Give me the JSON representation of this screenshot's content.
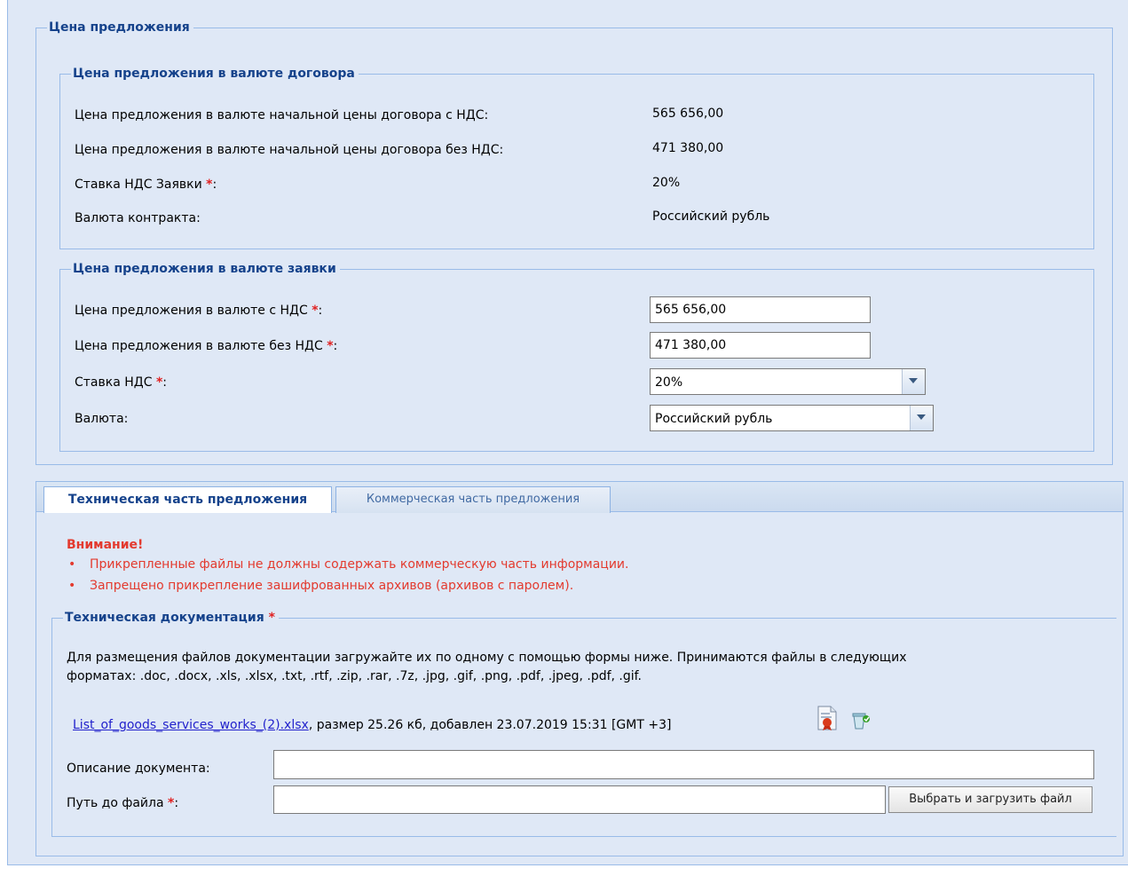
{
  "offer_price": {
    "legend": "Цена предложения",
    "contract_currency": {
      "legend": "Цена предложения в валюте договора",
      "rows": [
        {
          "label": "Цена предложения в валюте начальной цены договора с НДС:",
          "value": "565 656,00"
        },
        {
          "label": "Цена предложения в валюте начальной цены договора без НДС:",
          "value": "471 380,00"
        },
        {
          "label": "Ставка НДС Заявки",
          "value": "20%"
        },
        {
          "label": "Валюта контракта:",
          "value": "Российский рубль"
        }
      ]
    },
    "bid_currency": {
      "legend": "Цена предложения в валюте заявки",
      "price_with_vat_label": "Цена предложения в валюте с НДС",
      "price_with_vat_value": "565 656,00",
      "price_without_vat_label": "Цена предложения в валюте без НДС",
      "price_without_vat_value": "471 380,00",
      "vat_rate_label": "Ставка НДС",
      "vat_rate_value": "20%",
      "currency_label": "Валюта:",
      "currency_value": "Российский рубль"
    }
  },
  "required_mark": "*",
  "label_colon": ":",
  "tabs": [
    {
      "label": "Техническая часть предложения",
      "active": true
    },
    {
      "label": "Коммерческая часть предложения",
      "active": false
    }
  ],
  "warning": {
    "title": "Внимание!",
    "items": [
      "Прикрепленные файлы не должны содержать коммерческую часть информации.",
      "Запрещено прикрепление зашифрованных архивов (архивов с паролем)."
    ]
  },
  "tech_docs": {
    "legend": "Техническая документация",
    "description_line1": "Для размещения файлов документации загружайте их по одному с помощью формы ниже. Принимаются файлы в следующих",
    "description_line2": "форматах: .doc, .docx, .xls, .xlsx, .txt, .rtf, .zip, .rar, .7z, .jpg, .gif, .png, .pdf, .jpeg, .pdf, .gif.",
    "file_name": "List_of_goods_services_works_(2).xlsx",
    "file_info": ", размер 25.26 кб, добавлен 23.07.2019 15:31 [GMT +3]",
    "doc_description_label": "Описание документа:",
    "doc_description_value": "",
    "file_path_label": "Путь до файла",
    "file_path_value": "",
    "upload_button": "Выбрать и загрузить файл"
  },
  "colors": {
    "panel_bg": "#dfe8f6",
    "border": "#99bbe8",
    "legend_text": "#15428b",
    "warning": "#e33a2e",
    "required": "#e02020",
    "link": "#2222cc"
  }
}
